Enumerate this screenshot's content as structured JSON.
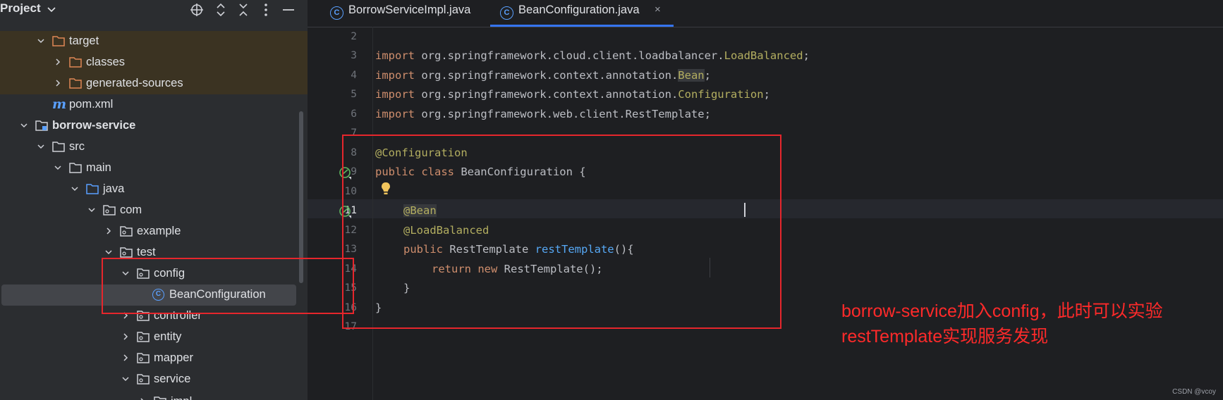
{
  "project_panel": {
    "title": "Project",
    "toolbar_icons": [
      "crosshair-icon",
      "expand-all-icon",
      "collapse-all-icon",
      "more-icon",
      "minimize-icon"
    ],
    "tree": [
      {
        "label": "target",
        "icon": "folder-orange",
        "expanded": true,
        "excluded": true
      },
      {
        "label": "classes",
        "icon": "folder-orange",
        "expanded": false,
        "excluded": true
      },
      {
        "label": "generated-sources",
        "icon": "folder-orange",
        "expanded": false,
        "excluded": true
      },
      {
        "label": "pom.xml",
        "icon": "maven-icon"
      },
      {
        "label": "borrow-service",
        "icon": "module-icon",
        "expanded": true,
        "bold": true
      },
      {
        "label": "src",
        "icon": "folder-icon",
        "expanded": true
      },
      {
        "label": "main",
        "icon": "folder-icon",
        "expanded": true
      },
      {
        "label": "java",
        "icon": "source-folder-icon",
        "expanded": true
      },
      {
        "label": "com",
        "icon": "package-icon",
        "expanded": true
      },
      {
        "label": "example",
        "icon": "package-icon",
        "expanded": false
      },
      {
        "label": "test",
        "icon": "package-icon",
        "expanded": true
      },
      {
        "label": "config",
        "icon": "package-icon",
        "expanded": true
      },
      {
        "label": "BeanConfiguration",
        "icon": "class-icon",
        "selected": true
      },
      {
        "label": "controller",
        "icon": "package-icon",
        "expanded": false
      },
      {
        "label": "entity",
        "icon": "package-icon",
        "expanded": false
      },
      {
        "label": "mapper",
        "icon": "package-icon",
        "expanded": false
      },
      {
        "label": "service",
        "icon": "package-icon",
        "expanded": true
      },
      {
        "label": "impl",
        "icon": "package-icon",
        "expanded": false
      }
    ]
  },
  "tabs": [
    {
      "label": "BorrowServiceImpl.java",
      "active": false
    },
    {
      "label": "BeanConfiguration.java",
      "active": true,
      "close": "×"
    }
  ],
  "editor": {
    "line_numbers": [
      "2",
      "3",
      "4",
      "5",
      "6",
      "7",
      "8",
      "9",
      "10",
      "11",
      "12",
      "13",
      "14",
      "15",
      "16",
      "17"
    ],
    "code": {
      "l3_kw": "import",
      "l3_pkg": " org.springframework.cloud.client.loadbalancer.",
      "l3_cls": "LoadBalanced",
      "l3_end": ";",
      "l4_kw": "import",
      "l4_pkg": " org.springframework.context.annotation.",
      "l4_cls": "Bean",
      "l4_end": ";",
      "l5_kw": "import",
      "l5_pkg": " org.springframework.context.annotation.",
      "l5_cls": "Configuration",
      "l5_end": ";",
      "l6_kw": "import",
      "l6_pkg": " org.springframework.web.client.RestTemplate;",
      "l8": "@Configuration",
      "l9_kw": "public class",
      "l9_rest": " BeanConfiguration {",
      "l11": "@Bean",
      "l12": "@LoadBalanced",
      "l13_kw": "public",
      "l13_type": " RestTemplate ",
      "l13_fn": "restTemplate",
      "l13_rest": "(){",
      "l14_kw1": "return",
      "l14_kw2": " new",
      "l14_rest": " RestTemplate();",
      "l15": "}",
      "l16": "}"
    }
  },
  "annotation": {
    "line1": "borrow-service加入config，此时可以实验",
    "line2": "restTemplate实现服务发现",
    "color": "#e6262c"
  },
  "watermark": "CSDN @vcoy",
  "colors": {
    "keyword": "#cf8e6d",
    "annotation": "#b3ae60",
    "method": "#56a8f5",
    "tab_accent": "#3574f0"
  }
}
